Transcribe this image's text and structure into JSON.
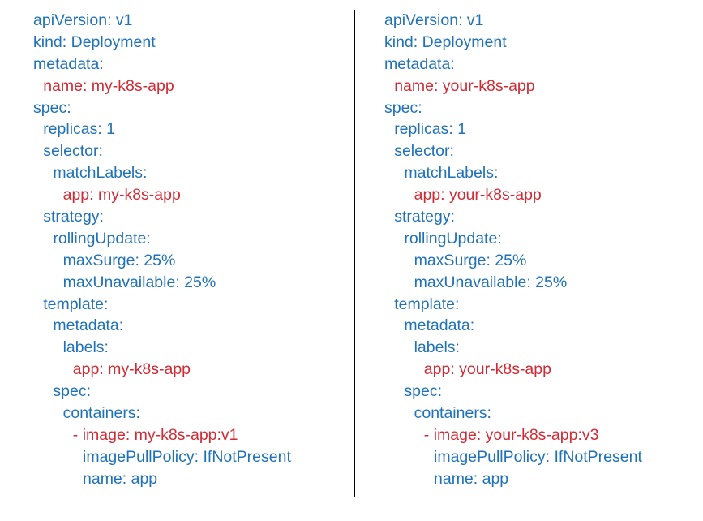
{
  "colors": {
    "key": "#1f72b8",
    "diff": "#d02b35"
  },
  "left": {
    "lines": [
      {
        "text": "apiVersion: v1",
        "indent": 0,
        "diff": false
      },
      {
        "text": "kind: Deployment",
        "indent": 0,
        "diff": false
      },
      {
        "text": "metadata:",
        "indent": 0,
        "diff": false
      },
      {
        "text": "name: my-k8s-app",
        "indent": 1,
        "diff": true
      },
      {
        "text": "spec:",
        "indent": 0,
        "diff": false
      },
      {
        "text": "replicas: 1",
        "indent": 1,
        "diff": false
      },
      {
        "text": "selector:",
        "indent": 1,
        "diff": false
      },
      {
        "text": "matchLabels:",
        "indent": 2,
        "diff": false
      },
      {
        "text": "app: my-k8s-app",
        "indent": 3,
        "diff": true
      },
      {
        "text": "strategy:",
        "indent": 1,
        "diff": false
      },
      {
        "text": "rollingUpdate:",
        "indent": 2,
        "diff": false
      },
      {
        "text": "maxSurge: 25%",
        "indent": 3,
        "diff": false
      },
      {
        "text": "maxUnavailable: 25%",
        "indent": 3,
        "diff": false
      },
      {
        "text": "template:",
        "indent": 1,
        "diff": false
      },
      {
        "text": "metadata:",
        "indent": 2,
        "diff": false
      },
      {
        "text": "labels:",
        "indent": 3,
        "diff": false
      },
      {
        "text": "app: my-k8s-app",
        "indent": 4,
        "diff": true
      },
      {
        "text": "spec:",
        "indent": 2,
        "diff": false
      },
      {
        "text": "containers:",
        "indent": 3,
        "diff": false
      },
      {
        "text": "- image: my-k8s-app:v1",
        "indent": 4,
        "diff": true
      },
      {
        "text": "imagePullPolicy: IfNotPresent",
        "indent": 5,
        "diff": false
      },
      {
        "text": "name: app",
        "indent": 5,
        "diff": false
      }
    ]
  },
  "right": {
    "lines": [
      {
        "text": "apiVersion: v1",
        "indent": 0,
        "diff": false
      },
      {
        "text": "kind: Deployment",
        "indent": 0,
        "diff": false
      },
      {
        "text": "metadata:",
        "indent": 0,
        "diff": false
      },
      {
        "text": "name: your-k8s-app",
        "indent": 1,
        "diff": true
      },
      {
        "text": "spec:",
        "indent": 0,
        "diff": false
      },
      {
        "text": "replicas: 1",
        "indent": 1,
        "diff": false
      },
      {
        "text": "selector:",
        "indent": 1,
        "diff": false
      },
      {
        "text": "matchLabels:",
        "indent": 2,
        "diff": false
      },
      {
        "text": "app: your-k8s-app",
        "indent": 3,
        "diff": true
      },
      {
        "text": "strategy:",
        "indent": 1,
        "diff": false
      },
      {
        "text": "rollingUpdate:",
        "indent": 2,
        "diff": false
      },
      {
        "text": "maxSurge: 25%",
        "indent": 3,
        "diff": false
      },
      {
        "text": "maxUnavailable: 25%",
        "indent": 3,
        "diff": false
      },
      {
        "text": "template:",
        "indent": 1,
        "diff": false
      },
      {
        "text": "metadata:",
        "indent": 2,
        "diff": false
      },
      {
        "text": "labels:",
        "indent": 3,
        "diff": false
      },
      {
        "text": "app: your-k8s-app",
        "indent": 4,
        "diff": true
      },
      {
        "text": "spec:",
        "indent": 2,
        "diff": false
      },
      {
        "text": "containers:",
        "indent": 3,
        "diff": false
      },
      {
        "text": "- image: your-k8s-app:v3",
        "indent": 4,
        "diff": true
      },
      {
        "text": "imagePullPolicy: IfNotPresent",
        "indent": 5,
        "diff": false
      },
      {
        "text": "name: app",
        "indent": 5,
        "diff": false
      }
    ]
  }
}
